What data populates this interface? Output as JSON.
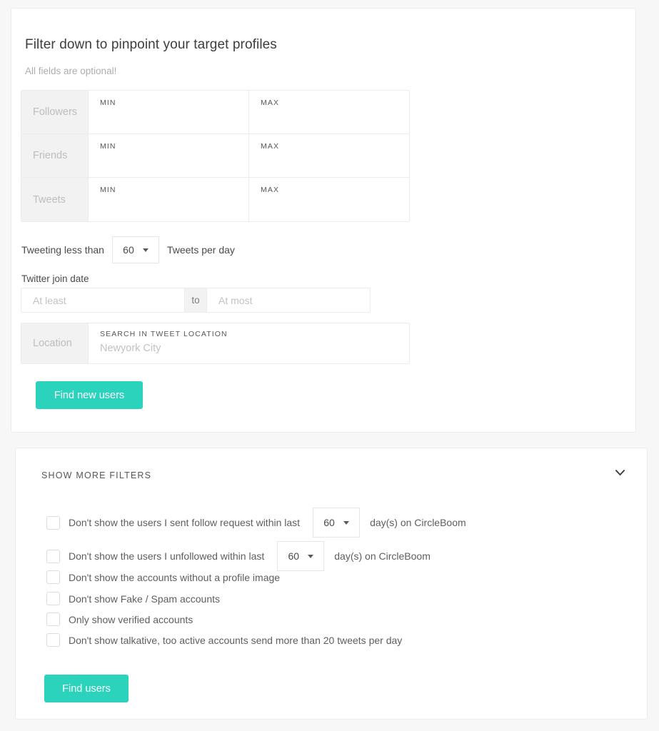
{
  "theme": {
    "accent": "#2bd3bd",
    "page_bg": "#f7f7f7",
    "card_bg": "#ffffff",
    "border": "#ececec",
    "label_bg": "#f2f2f2"
  },
  "filters_card": {
    "title": "Filter down to pinpoint your target profiles",
    "subtitle": "All fields are optional!",
    "minmax_table": {
      "rows": [
        {
          "label": "Followers",
          "min_caption": "MIN",
          "min_value": "",
          "max_caption": "MAX",
          "max_value": ""
        },
        {
          "label": "Friends",
          "min_caption": "MIN",
          "min_value": "",
          "max_caption": "MAX",
          "max_value": ""
        },
        {
          "label": "Tweets",
          "min_caption": "MIN",
          "min_value": "",
          "max_caption": "MAX",
          "max_value": ""
        }
      ]
    },
    "tweets_per_day": {
      "prefix": "Tweeting less than",
      "value": "60",
      "suffix": "Tweets per day"
    },
    "join_date": {
      "label": "Twitter join date",
      "from_placeholder": "At least",
      "separator": "to",
      "to_placeholder": "At most"
    },
    "location": {
      "label": "Location",
      "caption": "SEARCH IN TWEET LOCATION",
      "placeholder": "Newyork City",
      "value": ""
    },
    "submit_label": "Find new users"
  },
  "more_filters_card": {
    "header": "SHOW MORE FILTERS",
    "chevron": "chevron-down-icon",
    "options": [
      {
        "label": "Don't show the users I sent follow request within last",
        "checked": false,
        "days": "60",
        "suffix": "day(s) on CircleBoom"
      },
      {
        "label": "Don't show the users I unfollowed within last",
        "checked": false,
        "days": "60",
        "suffix": "day(s) on CircleBoom"
      },
      {
        "label": "Don't show the accounts without a profile image",
        "checked": false
      },
      {
        "label": "Don't show Fake / Spam accounts",
        "checked": false
      },
      {
        "label": "Only show verified accounts",
        "checked": false
      },
      {
        "label": "Don't show talkative, too active accounts send more than 20 tweets per day",
        "checked": false
      }
    ],
    "submit_label": "Find users"
  }
}
